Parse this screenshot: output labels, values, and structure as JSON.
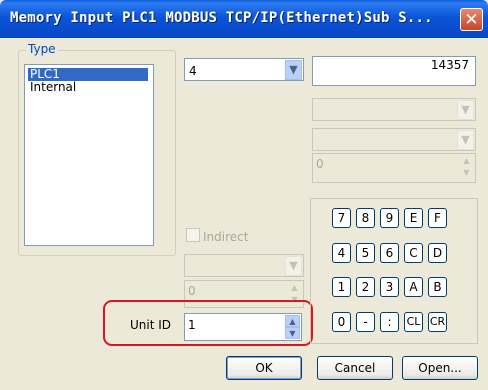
{
  "window": {
    "title": "Memory Input  PLC1 MODBUS TCP/IP(Ethernet)Sub S...",
    "close_icon": "✕"
  },
  "type_group": {
    "label": "Type",
    "items": [
      {
        "label": "PLC1",
        "selected": true
      },
      {
        "label": "Internal",
        "selected": false
      }
    ]
  },
  "address": {
    "device_combo_value": "4",
    "address_value": "14357",
    "bit_field_value": "0"
  },
  "indirect": {
    "label": "Indirect",
    "checked": false,
    "field_value": "0"
  },
  "unit_id": {
    "label": "Unit ID",
    "value": "1"
  },
  "keypad": {
    "rows": [
      [
        "7",
        "8",
        "9",
        "E",
        "F"
      ],
      [
        "4",
        "5",
        "6",
        "C",
        "D"
      ],
      [
        "1",
        "2",
        "3",
        "A",
        "B"
      ],
      [
        "0",
        "-",
        ":",
        "CL",
        "CR"
      ]
    ]
  },
  "buttons": {
    "ok": "OK",
    "cancel": "Cancel",
    "open": "Open..."
  },
  "colors": {
    "title_bar": "#0a55d8",
    "selection": "#316ac5",
    "highlight": "#e0141e"
  }
}
